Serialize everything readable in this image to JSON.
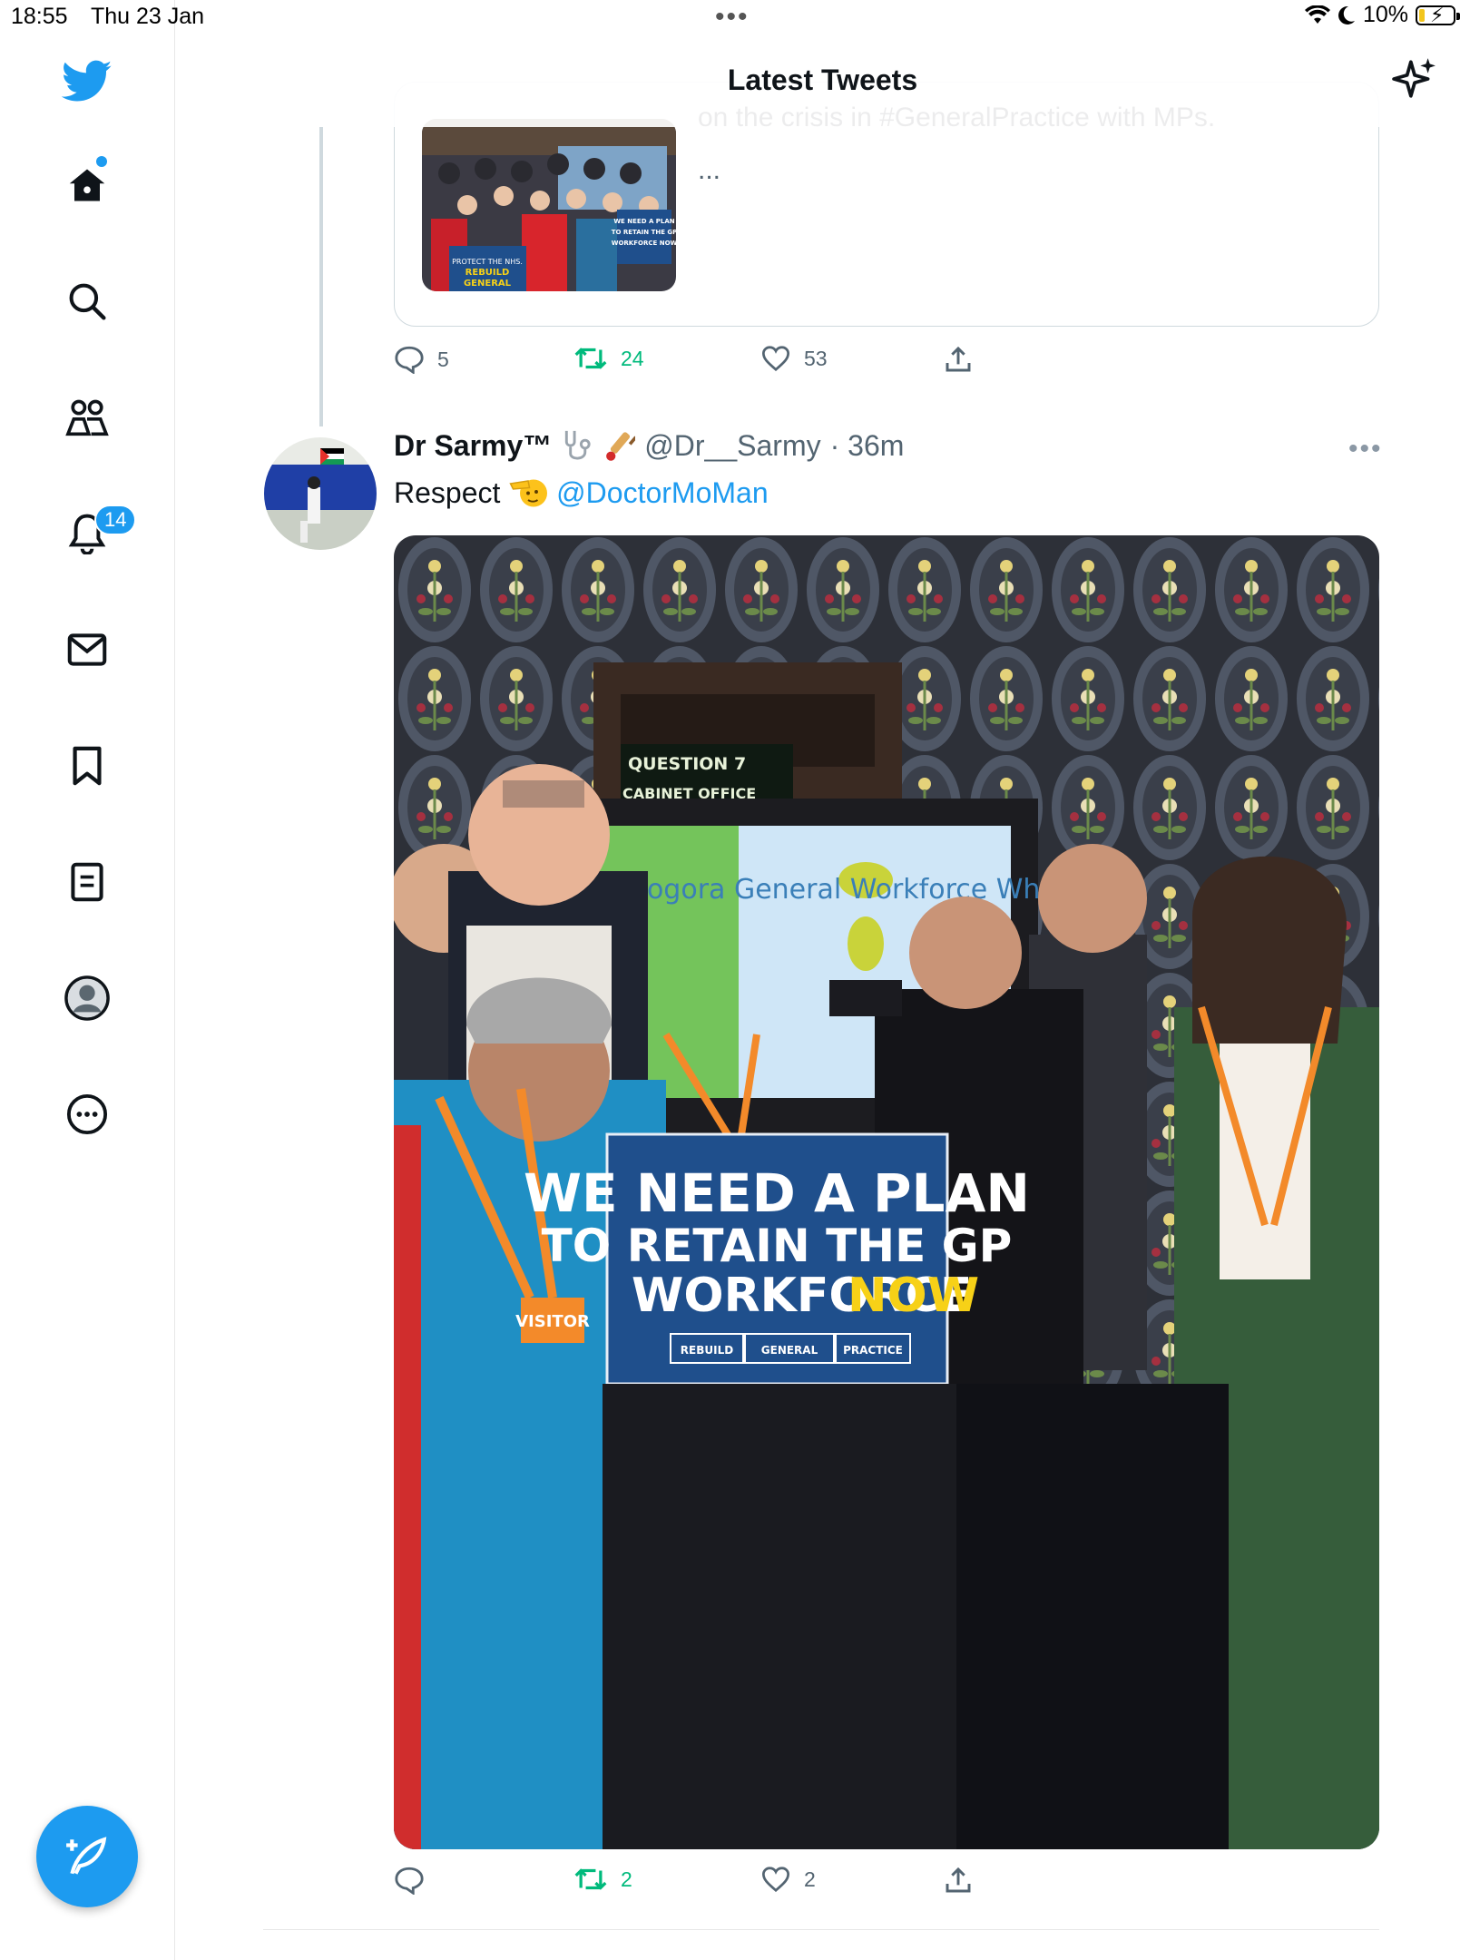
{
  "status_bar": {
    "time": "18:55",
    "date": "Thu 23 Jan",
    "battery": "10%"
  },
  "header": {
    "title": "Latest Tweets"
  },
  "sidebar": {
    "notifications_badge": "14",
    "items": [
      "twitter-logo",
      "home-icon",
      "search-icon",
      "communities-icon",
      "notifications-icon",
      "messages-icon",
      "bookmarks-icon",
      "lists-icon",
      "profile-icon",
      "more-icon"
    ]
  },
  "quoted_tweet": {
    "text": "on the crisis in #GeneralPractice with MPs.",
    "ellipsis": "...",
    "thumb_sign_a": "PROTECT THE NHS. REBUILD GENERAL PRACTICE",
    "thumb_sign_b": "WE NEED A PLAN TO RETAIN THE GP WORKFORCE NOW"
  },
  "quoted_actions": {
    "replies": "5",
    "retweets": "24",
    "likes": "53"
  },
  "tweet": {
    "name": "Dr Sarmy™",
    "handle": "@Dr__Sarmy",
    "time": "· 36m",
    "text": "Respect",
    "mention": "@DoctorMoMan",
    "photo": {
      "screen_line1": "QUESTION 7",
      "screen_line2": "CABINET OFFICE",
      "tv_text": "Cogora General Workforce Wh",
      "sign_line1": "WE NEED A PLAN",
      "sign_line2": "TO RETAIN THE GP",
      "sign_line3a": "WORKFORCE",
      "sign_line3b": "NOW",
      "sign_box1": "REBUILD",
      "sign_box2": "GENERAL",
      "sign_box3": "PRACTICE",
      "lanyard_tag": "VISITOR"
    }
  },
  "tweet_actions": {
    "replies": "",
    "retweets": "2",
    "likes": "2"
  },
  "colors": {
    "accent": "#1d9bf0",
    "retweet_green": "#00ba7c",
    "muted": "#536471",
    "sign_blue": "#1f4f8c",
    "sign_yellow": "#f7d117"
  }
}
